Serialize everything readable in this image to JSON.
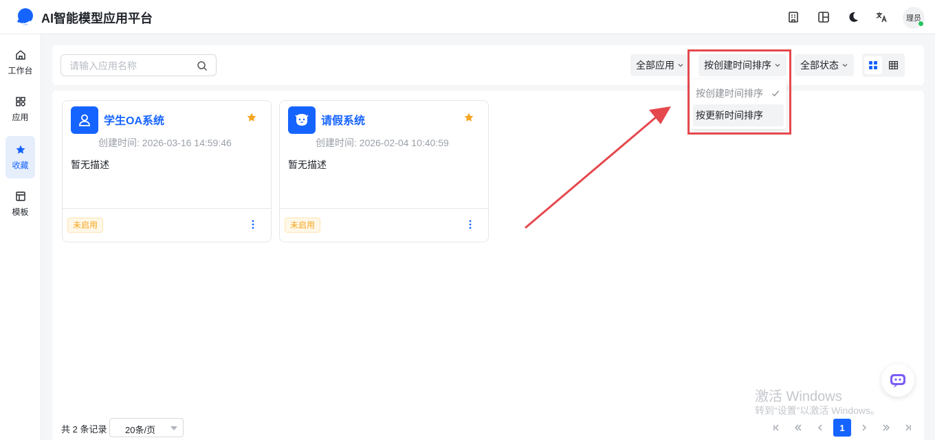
{
  "header": {
    "title": "AI智能模型应用平台",
    "icons": [
      "building-icon",
      "layout-icon",
      "moon-icon",
      "translate-icon"
    ],
    "user_label": "理员"
  },
  "sidebar": {
    "items": [
      {
        "label": "工作台",
        "icon": "home-icon"
      },
      {
        "label": "应用",
        "icon": "apps-icon"
      },
      {
        "label": "收藏",
        "icon": "star-icon",
        "active": true
      },
      {
        "label": "模板",
        "icon": "template-icon"
      }
    ]
  },
  "toolbar": {
    "search_placeholder": "请输入应用名称",
    "filter_type": "全部应用",
    "sort": "按创建时间排序",
    "status": "全部状态"
  },
  "sort_dropdown": {
    "options": [
      "按创建时间排序",
      "按更新时间排序"
    ],
    "selected_index": 0,
    "hover_index": 1
  },
  "apps": [
    {
      "name": "学生OA系统",
      "created": "创建时间: 2026-03-16 14:59:46",
      "desc": "暂无描述",
      "status": "未启用",
      "favorite": true,
      "icon": "user-icon"
    },
    {
      "name": "请假系统",
      "created": "创建时间: 2026-02-04 10:40:59",
      "desc": "暂无描述",
      "status": "未启用",
      "favorite": true,
      "icon": "bot-face-icon"
    }
  ],
  "pagination": {
    "total_text": "共 2 条记录",
    "page_size": "20条/页",
    "current_page": "1"
  },
  "watermark": {
    "line1": "激活 Windows",
    "line2": "转到“设置”以激活 Windows。"
  },
  "colors": {
    "primary": "#1664ff",
    "warning": "#f6a623",
    "annotation": "#e5484d"
  }
}
